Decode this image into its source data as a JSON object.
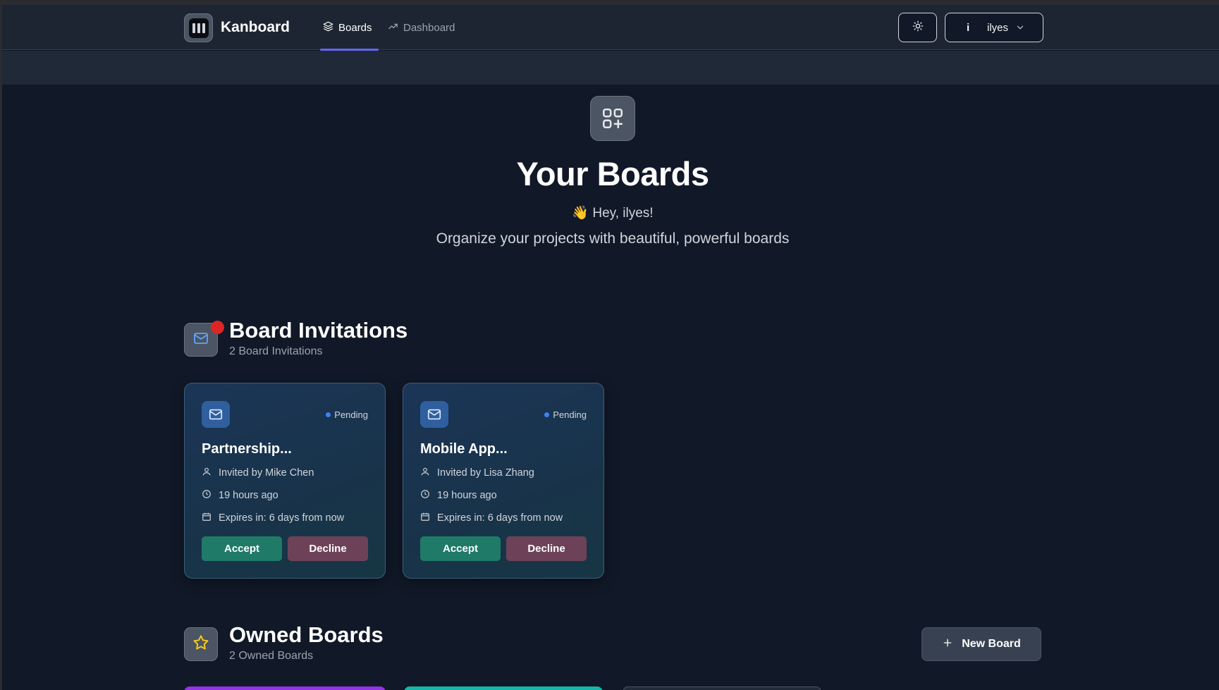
{
  "header": {
    "brand": "Kanboard",
    "nav": [
      {
        "label": "Boards",
        "icon": "layers-icon",
        "active": true
      },
      {
        "label": "Dashboard",
        "icon": "trending-up-icon",
        "active": false
      }
    ],
    "theme_toggle_icon": "sun-icon",
    "user": {
      "initial": "i",
      "name": "ilyes"
    }
  },
  "hero": {
    "icon": "grid-plus-icon",
    "title": "Your Boards",
    "greeting": "👋 Hey, ilyes!",
    "subtitle": "Organize your projects with beautiful, powerful boards"
  },
  "invitations": {
    "title": "Board Invitations",
    "count_label": "2 Board Invitations",
    "has_notification": true,
    "items": [
      {
        "title": "Partnership...",
        "status": "Pending",
        "invited_by": "Invited by Mike Chen",
        "time": "19 hours ago",
        "expires": "Expires in: 6 days from now",
        "accept": "Accept",
        "decline": "Decline"
      },
      {
        "title": "Mobile App...",
        "status": "Pending",
        "invited_by": "Invited by Lisa Zhang",
        "time": "19 hours ago",
        "expires": "Expires in: 6 days from now",
        "accept": "Accept",
        "decline": "Decline"
      }
    ]
  },
  "owned": {
    "title": "Owned Boards",
    "count_label": "2 Owned Boards",
    "new_board_label": "New Board",
    "card_colors": [
      "#9333ea",
      "#14b8a6",
      "#4b5563"
    ]
  },
  "colors": {
    "accent": "#6366f1",
    "accept": "#1f7a68",
    "decline": "#6d4258",
    "badge": "#dc2626"
  }
}
